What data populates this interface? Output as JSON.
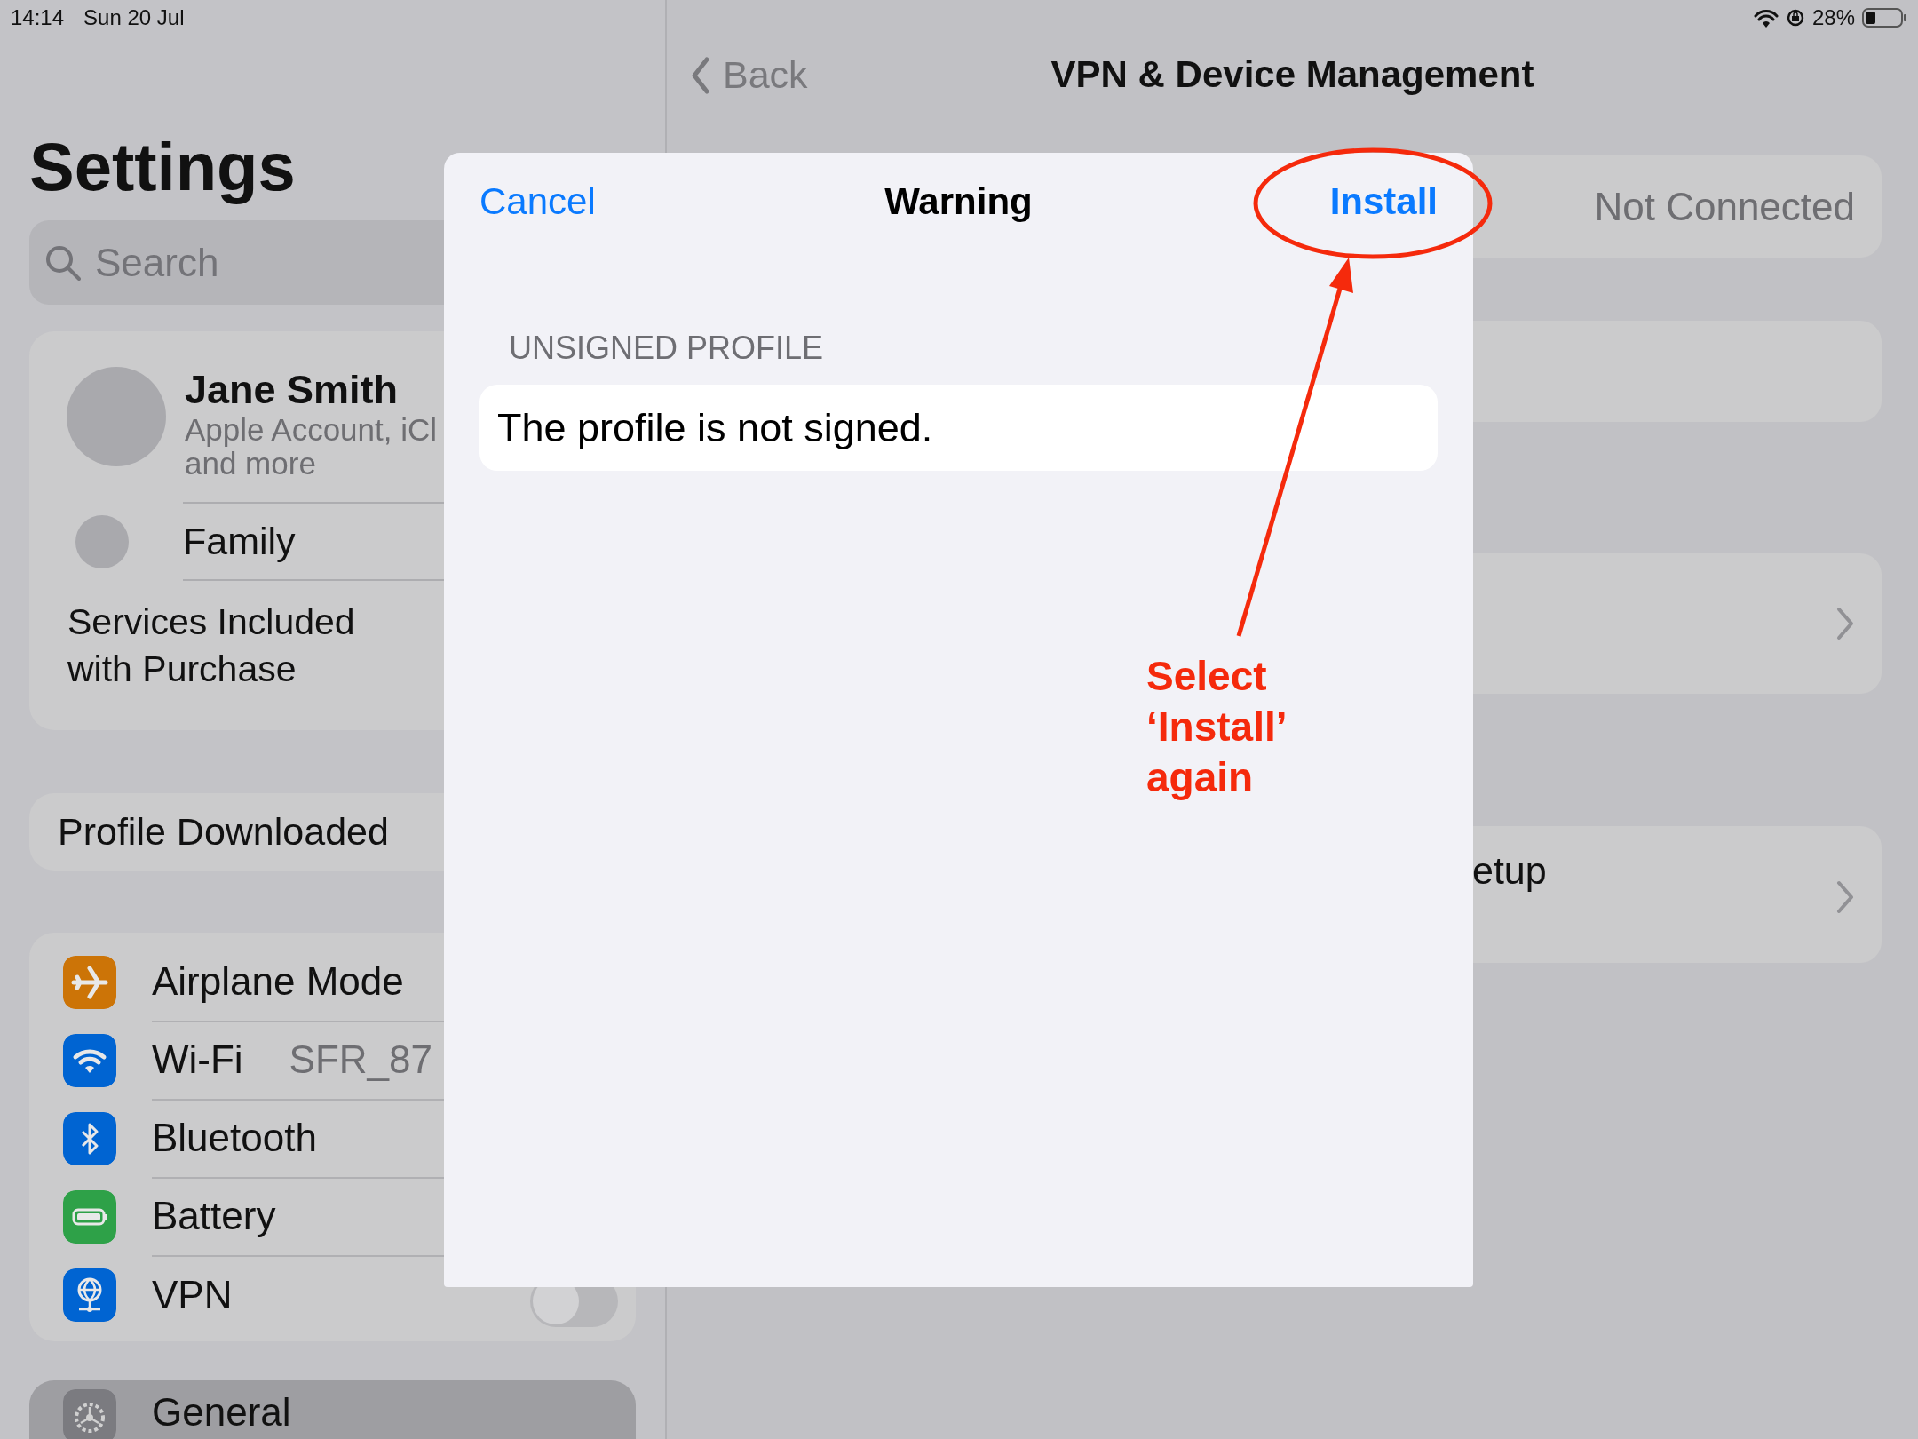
{
  "status_bar": {
    "time": "14:14",
    "date": "Sun 20 Jul",
    "battery_text": "28%"
  },
  "sidebar": {
    "title": "Settings",
    "search": {
      "placeholder": "Search"
    },
    "account": {
      "name": "Jane Smith",
      "subtitle_lines": [
        "Apple Account, iCl",
        "and more"
      ]
    },
    "family": "Family",
    "services": "Services Included with Purchase",
    "profile_downloaded": "Profile Downloaded",
    "settings_rows": [
      {
        "label": "Airplane Mode",
        "kind": "plain"
      },
      {
        "label": "Wi-Fi",
        "value": "SFR_87",
        "kind": "value"
      },
      {
        "label": "Bluetooth",
        "kind": "plain"
      },
      {
        "label": "Battery",
        "kind": "plain"
      },
      {
        "label": "VPN",
        "kind": "toggle",
        "on": false
      }
    ],
    "general_rows": [
      {
        "label": "General"
      }
    ]
  },
  "detail": {
    "back": "Back",
    "title": "VPN & Device Management",
    "cards": [
      {
        "kind": "status",
        "value": "Not Connected"
      },
      {
        "kind": "blank"
      },
      {
        "kind": "link"
      },
      {
        "kind": "link",
        "label": "etup"
      }
    ]
  },
  "modal": {
    "cancel": "Cancel",
    "title": "Warning",
    "action": "Install",
    "section_header": "UNSIGNED PROFILE",
    "message": "The profile is not signed."
  },
  "annotation": {
    "text": "Select ‘Install’ again"
  }
}
